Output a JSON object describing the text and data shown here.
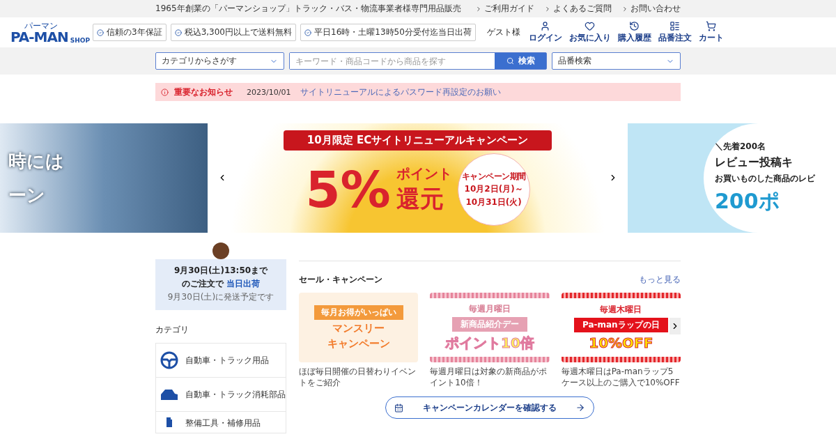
{
  "top_bar": {
    "tagline": "1965年創業の「パーマンショップ」トラック・バス・物流事業者様専門用品販売",
    "links": [
      {
        "label": "ご利用ガイド"
      },
      {
        "label": "よくあるご質問"
      },
      {
        "label": "お問い合わせ"
      }
    ]
  },
  "header": {
    "logo": {
      "ruby": "パーマン",
      "main": "PA-MAN",
      "sub": "SHOP"
    },
    "badges": [
      {
        "text": "信頼の3年保証"
      },
      {
        "text": "税込3,300円以上で送料無料"
      },
      {
        "text": "平日16時・土曜13時50分受付迄当日出荷"
      }
    ],
    "user": "ゲスト様",
    "nav": [
      {
        "label": "ログイン"
      },
      {
        "label": "お気に入り"
      },
      {
        "label": "購入履歴"
      },
      {
        "label": "品番注文"
      },
      {
        "label": "カート"
      }
    ]
  },
  "search": {
    "category": "カテゴリからさがす",
    "placeholder": "キーワード・商品コードから商品を探す",
    "button": "検索",
    "part_search": "品番検索"
  },
  "notice": {
    "label": "重要なお知らせ",
    "date": "2023/10/01",
    "link": "サイトリニューアルによるパスワード再設定のお願い"
  },
  "carousel": {
    "left": {
      "line1": "時には",
      "line2": "ーン"
    },
    "main": {
      "title": "10月限定 ECサイトリニューアルキャンペーン",
      "big": "5%",
      "point": "ポイント",
      "back": "還元",
      "period_label": "キャンペーン期間",
      "period_start": "10月2日(月)～",
      "period_end": "10月31日(火)"
    },
    "right": {
      "line1": "＼先着200名",
      "line2": "レビュー投稿キ",
      "line3": "お買いものした商品のレビ",
      "line4": "200ポ"
    }
  },
  "shipping": {
    "line1": "9月30日(土)13:50まで",
    "line2": "のご注文で",
    "highlight": "当日出荷",
    "note": "9月30日(土)に発送予定です"
  },
  "categories": {
    "title": "カテゴリ",
    "items": [
      {
        "label": "自動車・トラック用品"
      },
      {
        "label": "自動車・トラック消耗部品"
      },
      {
        "label": "整備工具・補修用品"
      }
    ]
  },
  "sale": {
    "title": "セール・キャンペーン",
    "more": "もっと見る",
    "cards": [
      {
        "kind": "monthly",
        "top": "毎月お得がいっぱい",
        "main": "マンスリー",
        "sub": "キャンペーン",
        "caption": "ほぼ毎日開催の日替わりイベントをご紹介"
      },
      {
        "kind": "pink",
        "top": "毎週月曜日",
        "main": "新商品紹介デー",
        "sub": "ポイント10倍",
        "caption": "毎週月曜日は対象の新商品がポイント10倍！"
      },
      {
        "kind": "red",
        "top": "毎週木曜日",
        "main": "Pa-manラップの日",
        "sub": "10%OFF",
        "caption": "毎週木曜日はPa-manラップ5ケース以上のご購入で10%OFF"
      }
    ],
    "calendar_button": "キャンペーンカレンダーを確認する"
  }
}
